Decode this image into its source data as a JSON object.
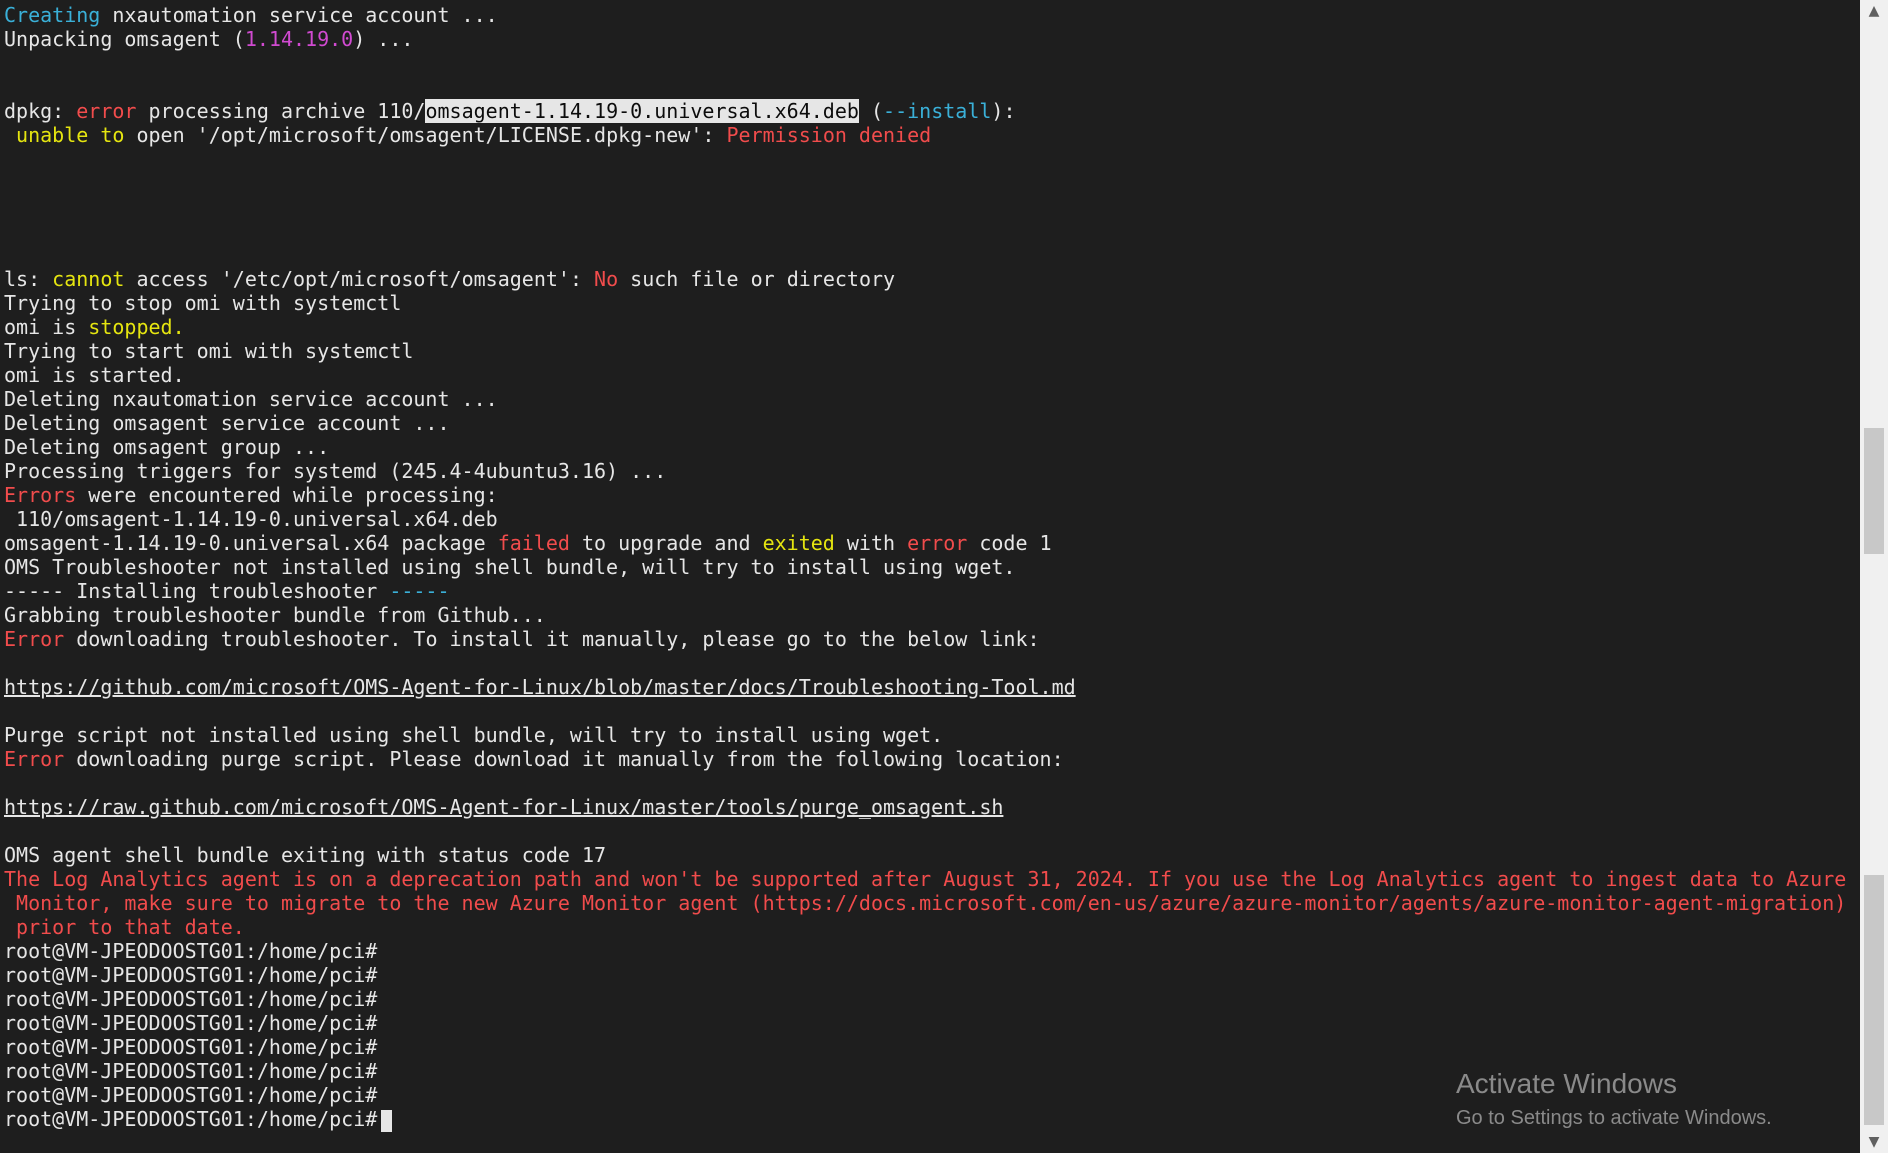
{
  "terminal": {
    "l1_a": "Creating",
    "l1_b": " nxautomation service account ...",
    "l2_a": "Unpacking omsagent (",
    "l2_b": "1.14.19.0",
    "l2_c": ") ...",
    "l5_a": "dpkg: ",
    "l5_b": "error",
    "l5_c": " processing archive 110/",
    "l5_d": "omsagent-1.14.19-0.universal.x64.deb",
    "l5_e": " (",
    "l5_f": "--install",
    "l5_g": "):",
    "l6_a": " ",
    "l6_b": "unable to",
    "l6_c": " open '/opt/microsoft/omsagent/LICENSE.dpkg-new': ",
    "l6_d": "Permission denied",
    "l12_a": "ls: ",
    "l12_b": "cannot",
    "l12_c": " access '/etc/opt/microsoft/omsagent': ",
    "l12_d": "No",
    "l12_e": " such file or directory",
    "l13": "Trying to stop omi with systemctl",
    "l14_a": "omi is ",
    "l14_b": "stopped.",
    "l15": "Trying to start omi with systemctl",
    "l16": "omi is started.",
    "l17": "Deleting nxautomation service account ...",
    "l18": "Deleting omsagent service account ...",
    "l19": "Deleting omsagent group ...",
    "l20": "Processing triggers for systemd (245.4-4ubuntu3.16) ...",
    "l21_a": "Errors",
    "l21_b": " were encountered while processing:",
    "l22": " 110/omsagent-1.14.19-0.universal.x64.deb",
    "l23_a": "omsagent-1.14.19-0.universal.x64 package ",
    "l23_b": "failed",
    "l23_c": " to upgrade and ",
    "l23_d": "exited",
    "l23_e": " with ",
    "l23_f": "error",
    "l23_g": " code 1",
    "l24": "OMS Troubleshooter not installed using shell bundle, will try to install using wget.",
    "l25_a": "----- Installing troubleshooter ",
    "l25_b": "-----",
    "l26": "Grabbing troubleshooter bundle from Github...",
    "l27_a": "Error",
    "l27_b": " downloading troubleshooter. To install it manually, please go to the below link:",
    "l29": "https://github.com/microsoft/OMS-Agent-for-Linux/blob/master/docs/Troubleshooting-Tool.md",
    "l31": "Purge script not installed using shell bundle, will try to install using wget.",
    "l32_a": "Error",
    "l32_b": " downloading purge script. Please download it manually from the following location:",
    "l34": "https://raw.github.com/microsoft/OMS-Agent-for-Linux/master/tools/purge_omsagent.sh",
    "l36": "OMS agent shell bundle exiting with status code 17",
    "l37": "The Log Analytics agent is on a deprecation path and won't be supported after August 31, 2024. If you use the Log Analytics agent to ingest data to Azure",
    "l38": " Monitor, make sure to migrate to the new Azure Monitor agent (https://docs.microsoft.com/en-us/azure/azure-monitor/agents/azure-monitor-agent-migration)",
    "l39": " prior to that date.",
    "prompt": "root@VM-JPEODOOSTG01:/home/pci#"
  },
  "watermark": {
    "title": "Activate Windows",
    "subtitle": "Go to Settings to activate Windows."
  },
  "colors": {
    "background": "#1e1e1e",
    "text": "#e6e6e6",
    "cyan": "#3ab0d8",
    "magenta": "#d14ad1",
    "red": "#f14c4c",
    "yellow": "#e5e510"
  }
}
